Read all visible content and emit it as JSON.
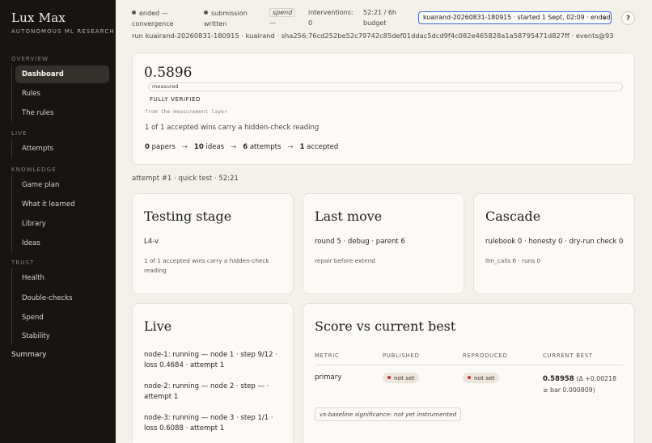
{
  "sidebar": {
    "brand": "Lux Max",
    "subtitle": "AUTONOMOUS ML RESEARCH",
    "sections": {
      "overview": "OVERVIEW",
      "live": "LIVE",
      "knowledge": "KNOWLEDGE",
      "trust": "TRUST"
    },
    "items": {
      "dashboard": "Dashboard",
      "rules": "Rules",
      "the_rules": "The rules",
      "attempts": "Attempts",
      "game_plan": "Game plan",
      "what_it_learned": "What it learned",
      "library": "Library",
      "ideas": "Ideas",
      "health": "Health",
      "double_checks": "Double-checks",
      "spend": "Spend",
      "stability": "Stability"
    },
    "summary": "Summary"
  },
  "topbar": {
    "status1_a": "ended —",
    "status1_b": "convergence",
    "status2_a": "submission",
    "status2_b": "written",
    "spend_label": "spend",
    "spend_value": "—",
    "interventions_label": "interventions:",
    "interventions_value": "0",
    "budget_value": "52:21 / 6h",
    "budget_label": "budget",
    "run_select": "kuairand-20260831-180915 · started 1 Sept, 02:09 · ended",
    "help": "?",
    "run_line": "run kuairand-20260831-180915 · kuairand · sha256:76cd252be52c79742c85def01ddac5dcd9f4c082e465828a1a58795471d827ff · events@93"
  },
  "summary_card": {
    "score": "0.5896",
    "measured": "measured",
    "verified": "FULLY VERIFIED",
    "from_layer": "from the measurement layer",
    "wins": "1 of 1 accepted wins carry a hidden-check reading",
    "pipeline": {
      "papers_n": "0",
      "papers": "papers",
      "ideas_n": "10",
      "ideas": "ideas",
      "attempts_n": "6",
      "attempts": "attempts",
      "accepted_n": "1",
      "accepted": "accepted",
      "arrow": "→"
    }
  },
  "attempt_line": "attempt #1 · quick test · 52:21",
  "testing": {
    "title": "Testing stage",
    "value": "L4-v",
    "note_1": "1 of 1 accepted wins carry a hidden-check",
    "note_2": "reading"
  },
  "last_move": {
    "title": "Last move",
    "value": "round 5 · debug · parent 6",
    "note": "repair before extend"
  },
  "cascade": {
    "title": "Cascade",
    "value": "rulebook 0 · honesty 0 · dry-run check 0",
    "note": "llm_calls 6 · runs 0"
  },
  "live": {
    "title": "Live",
    "node1_a": "node-1: running — node 1 · step 9/12 ·",
    "node1_b": "loss 0.4684 · attempt 1",
    "node2_a": "node-2: running — node 2 · step — ·",
    "node2_b": "attempt 1",
    "node3_a": "node-3: running — node 3 · step 1/1 ·",
    "node3_b": "loss 0.6088 · attempt 1"
  },
  "score_table": {
    "title": "Score vs current best",
    "headers": {
      "metric": "METRIC",
      "published": "PUBLISHED",
      "reproduced": "REPRODUCED",
      "current_best": "CURRENT BEST"
    },
    "row": {
      "metric": "primary",
      "published": "not set",
      "reproduced": "not set",
      "best_value": "0.58958",
      "best_delta": "(Δ +0.00218",
      "best_bar": "≥ bar 0.000809)"
    },
    "significance": "vs-baseline significance: not yet instrumented"
  },
  "colors": {
    "sidebar_bg": "#161514",
    "page_bg": "#f4f1ea",
    "accent_select": "#3a6ad6",
    "badge_dot": "#c0362c"
  }
}
